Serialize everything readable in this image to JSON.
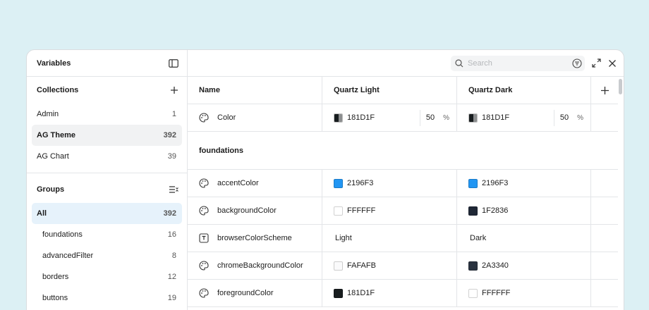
{
  "sidebar": {
    "title": "Variables",
    "collections": {
      "label": "Collections",
      "items": [
        {
          "label": "Admin",
          "count": "1"
        },
        {
          "label": "AG Theme",
          "count": "392"
        },
        {
          "label": "AG Chart",
          "count": "39"
        }
      ]
    },
    "groups": {
      "label": "Groups",
      "items": [
        {
          "label": "All",
          "count": "392"
        },
        {
          "label": "foundations",
          "count": "16"
        },
        {
          "label": "advancedFilter",
          "count": "8"
        },
        {
          "label": "borders",
          "count": "12"
        },
        {
          "label": "buttons",
          "count": "19"
        }
      ]
    }
  },
  "toolbar": {
    "search_placeholder": "Search"
  },
  "table": {
    "headers": {
      "name": "Name",
      "light": "Quartz Light",
      "dark": "Quartz Dark"
    },
    "top_row": {
      "name": "Color",
      "light": {
        "hex": "181D1F",
        "opacity": "50",
        "unit": "%"
      },
      "dark": {
        "hex": "181D1F",
        "opacity": "50",
        "unit": "%"
      }
    },
    "group_label": "foundations",
    "rows": [
      {
        "name": "accentColor",
        "icon": "palette-icon",
        "light": "2196F3",
        "light_color": "#2196F3",
        "dark": "2196F3",
        "dark_color": "#2196F3"
      },
      {
        "name": "backgroundColor",
        "icon": "palette-icon",
        "light": "FFFFFF",
        "light_color": "#FFFFFF",
        "dark": "1F2836",
        "dark_color": "#1F2836"
      },
      {
        "name": "browserColorScheme",
        "icon": "text-icon",
        "light": "Light",
        "dark": "Dark"
      },
      {
        "name": "chromeBackgroundColor",
        "icon": "palette-icon",
        "light": "FAFAFB",
        "light_color": "#FAFAFB",
        "dark": "2A3340",
        "dark_color": "#2A3340"
      },
      {
        "name": "foregroundColor",
        "icon": "palette-icon",
        "light": "181D1F",
        "light_color": "#181D1F",
        "dark": "FFFFFF",
        "dark_color": "#FFFFFF"
      }
    ]
  },
  "colors": {
    "background": "#dcf0f4",
    "active_group_bg": "#e6f2fb",
    "selected_collection_bg": "#f1f2f3"
  }
}
